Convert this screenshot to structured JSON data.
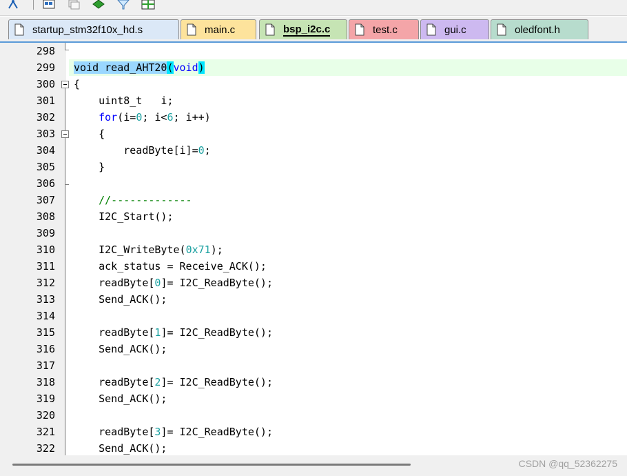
{
  "toolbar": {
    "buttons": [
      "hierarchy-icon",
      "window-icon",
      "copy-icon",
      "diamond-icon",
      "filter-icon",
      "grid-icon"
    ]
  },
  "tabs": [
    {
      "label": "startup_stm32f10x_hd.s",
      "color": "#dbe8f7",
      "active": false
    },
    {
      "label": "main.c",
      "color": "#fde39c",
      "active": false
    },
    {
      "label": "bsp_i2c.c",
      "color": "#c6e4b4",
      "active": true
    },
    {
      "label": "test.c",
      "color": "#f4a5a8",
      "active": false
    },
    {
      "label": "gui.c",
      "color": "#cdb9f0",
      "active": false
    },
    {
      "label": "oledfont.h",
      "color": "#b7dccd",
      "active": false
    }
  ],
  "lines": [
    {
      "num": "298"
    },
    {
      "num": "299"
    },
    {
      "num": "300"
    },
    {
      "num": "301"
    },
    {
      "num": "302"
    },
    {
      "num": "303"
    },
    {
      "num": "304"
    },
    {
      "num": "305"
    },
    {
      "num": "306"
    },
    {
      "num": "307"
    },
    {
      "num": "308"
    },
    {
      "num": "309"
    },
    {
      "num": "310"
    },
    {
      "num": "311"
    },
    {
      "num": "312"
    },
    {
      "num": "313"
    },
    {
      "num": "314"
    },
    {
      "num": "315"
    },
    {
      "num": "316"
    },
    {
      "num": "317"
    },
    {
      "num": "318"
    },
    {
      "num": "319"
    },
    {
      "num": "320"
    },
    {
      "num": "321"
    },
    {
      "num": "322"
    }
  ],
  "code": {
    "l299": {
      "a": "void read_AHT20",
      "b": "(",
      "c": "void",
      "d": ")"
    },
    "l300": "{",
    "l301": "    uint8_t   i;",
    "l302": {
      "kw": "for",
      "a": "(i=",
      "n1": "0",
      "b": "; i<",
      "n2": "6",
      "c": "; i++)"
    },
    "l303": "    {",
    "l304": {
      "a": "        readByte[i]=",
      "n": "0",
      "b": ";"
    },
    "l305": "    }",
    "l307": "//-------------",
    "l308": "    I2C_Start();",
    "l310": {
      "a": "    I2C_WriteByte(",
      "n": "0x71",
      "b": ");"
    },
    "l311": "    ack_status = Receive_ACK();",
    "l312": {
      "a": "    readByte[",
      "n": "0",
      "b": "]= I2C_ReadByte();"
    },
    "l313": "    Send_ACK();",
    "l315": {
      "a": "    readByte[",
      "n": "1",
      "b": "]= I2C_ReadByte();"
    },
    "l316": "    Send_ACK();",
    "l318": {
      "a": "    readByte[",
      "n": "2",
      "b": "]= I2C_ReadByte();"
    },
    "l319": "    Send_ACK();",
    "l321": {
      "a": "    readByte[",
      "n": "3",
      "b": "]= I2C_ReadByte();"
    },
    "l322": "    Send_ACK();"
  },
  "watermark": "CSDN @qq_52362275"
}
